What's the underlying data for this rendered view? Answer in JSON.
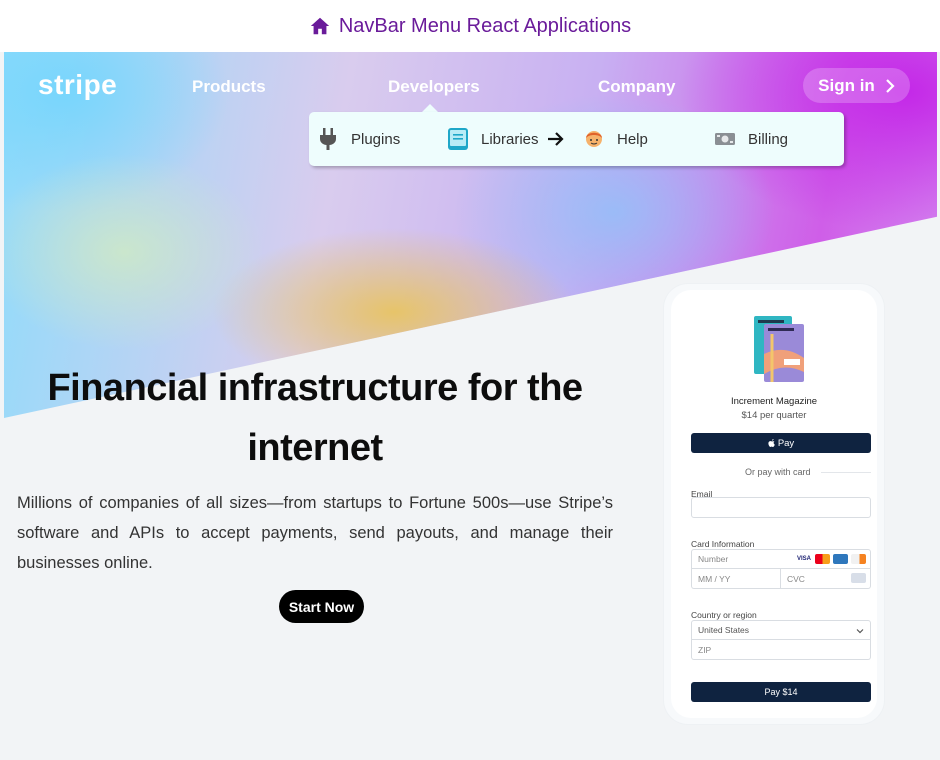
{
  "page": {
    "title": "NavBar Menu React Applications"
  },
  "nav": {
    "logo": "stripe",
    "links": [
      "Products",
      "Developers",
      "Company"
    ],
    "signin_label": "Sign in"
  },
  "dropdown": {
    "items": [
      {
        "label": "Plugins",
        "icon": "plug-icon"
      },
      {
        "label": "Libraries",
        "icon": "book-icon"
      },
      {
        "label": "Help",
        "icon": "person-icon"
      },
      {
        "label": "Billing",
        "icon": "money-icon"
      }
    ]
  },
  "hero": {
    "headline_line1": "Financial infrastructure for the",
    "headline_line2": "internet",
    "description": "Millions of companies of all sizes—from startups to Fortune 500s—use Stripe’s software and APIs to accept payments, send payouts, and manage their businesses online.",
    "cta_label": "Start Now"
  },
  "checkout": {
    "product_name": "Increment Magazine",
    "product_price": "$14 per quarter",
    "apple_pay_label": "Pay",
    "or_pay_text": "Or pay with card",
    "email_label": "Email",
    "card_label": "Card Information",
    "number_placeholder": "Number",
    "expiry_placeholder": "MM / YY",
    "cvc_placeholder": "CVC",
    "country_label": "Country or region",
    "country_value": "United States",
    "zip_placeholder": "ZIP",
    "pay_button_label": "Pay $14",
    "card_logo_labels": "VISA"
  },
  "colors": {
    "title_purple": "#6a1b9a",
    "dark_navy": "#0f2340",
    "dropdown_bg": "#eefdfd"
  }
}
